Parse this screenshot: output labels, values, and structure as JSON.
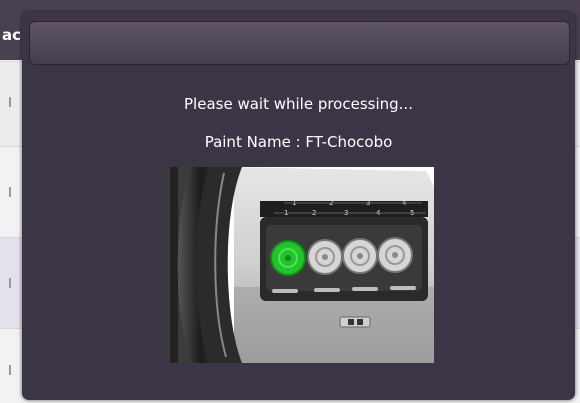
{
  "background": {
    "header_text": "ac"
  },
  "dialog": {
    "processing_message": "Please wait while processing...",
    "paint_name_label": "Paint Name : FT-Chocobo",
    "illustration": {
      "icon": "paint-machine-illustration",
      "scale_top": [
        "1",
        "2",
        "3",
        "4"
      ],
      "scale_bottom": [
        "1",
        "2",
        "3",
        "4",
        "5"
      ],
      "active_color": "#22c42a",
      "inactive_color": "#d6d6d6"
    }
  }
}
